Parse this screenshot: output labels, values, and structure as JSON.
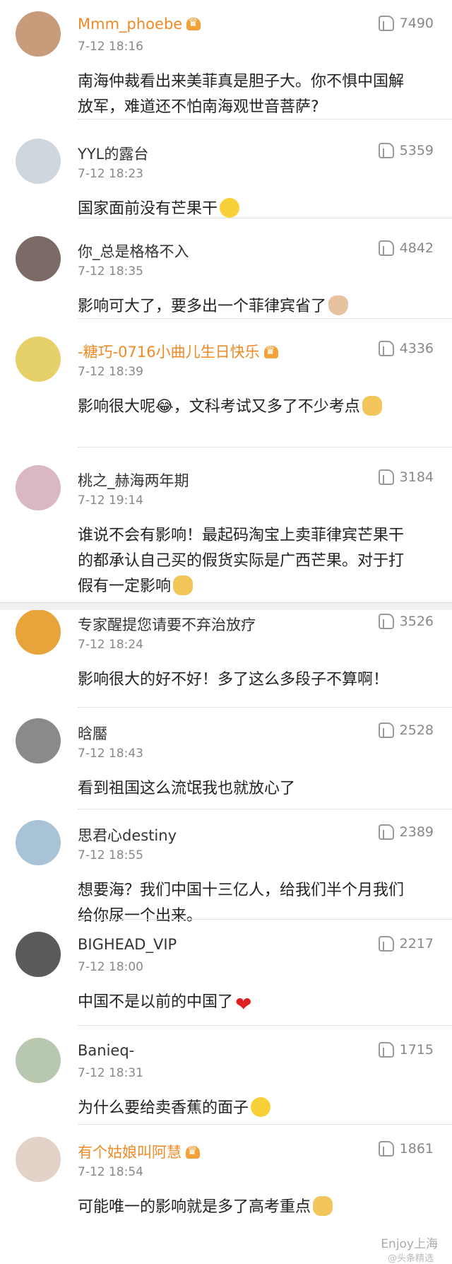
{
  "comments": [
    {
      "user": "Mmm_phoebe",
      "vip": true,
      "time": "7-12 18:16",
      "likes": "7490",
      "text": "南海仲裁看出来美菲真是胆子大。你不惧中国解放军，难道还不怕南海观世音菩萨?",
      "emoji": "",
      "avatar_color": "#c89b7b"
    },
    {
      "user": "YYL的露台",
      "vip": false,
      "time": "7-12 18:23",
      "likes": "5359",
      "text": "国家面前没有芒果干",
      "emoji": "yellow",
      "avatar_color": "#cfd6dd"
    },
    {
      "user": "你_总是格格不入",
      "vip": false,
      "time": "7-12 18:35",
      "likes": "4842",
      "text": "影响可大了，要多出一个菲律宾省了",
      "emoji": "cat",
      "avatar_color": "#7b6a66"
    },
    {
      "user": "-糖巧-0716小曲儿生日快乐",
      "vip": true,
      "time": "7-12 18:39",
      "likes": "4336",
      "text": "影响很大呢😂，文科考试又多了不少考点",
      "emoji": "doge",
      "avatar_color": "#e5d06a"
    },
    {
      "user": "桃之_赫海两年期",
      "vip": false,
      "time": "7-12 19:14",
      "likes": "3184",
      "text": "谁说不会有影响！最起码淘宝上卖菲律宾芒果干的都承认自己买的假货实际是广西芒果。对于打假有一定影响",
      "emoji": "doge",
      "avatar_color": "#d9b8c4"
    },
    {
      "user": "专家醒提您请要不弃治放疗",
      "vip": false,
      "time": "7-12 18:24",
      "likes": "3526",
      "text": "影响很大的好不好！多了这么多段子不算啊！",
      "emoji": "",
      "avatar_color": "#e8a33a"
    },
    {
      "user": "晗靨",
      "vip": false,
      "time": "7-12 18:43",
      "likes": "2528",
      "text": "看到祖国这么流氓我也就放心了",
      "emoji": "",
      "avatar_color": "#8a8a8a"
    },
    {
      "user": "思君心destiny",
      "vip": false,
      "time": "7-12 18:55",
      "likes": "2389",
      "text": "想要海？我们中国十三亿人，给我们半个月我们给你尿一个出来。",
      "emoji": "",
      "avatar_color": "#a9c3d6"
    },
    {
      "user": "BIGHEAD_VIP",
      "vip": false,
      "time": "7-12 18:00",
      "likes": "2217",
      "text": "中国不是以前的中国了",
      "emoji": "heart",
      "avatar_color": "#5a5a5a"
    },
    {
      "user": "Banieq-",
      "vip": false,
      "time": "7-12 18:31",
      "likes": "1715",
      "text": "为什么要给卖香蕉的面子",
      "emoji": "yellow",
      "avatar_color": "#b7c7b0"
    },
    {
      "user": "有个姑娘叫阿慧",
      "vip": true,
      "time": "7-12 18:54",
      "likes": "1861",
      "text": "可能唯一的影响就是多了高考重点",
      "emoji": "doge",
      "avatar_color": "#e2d2c8"
    }
  ],
  "watermark": "Enjoy上海",
  "weibo_mark": "@头条精选"
}
